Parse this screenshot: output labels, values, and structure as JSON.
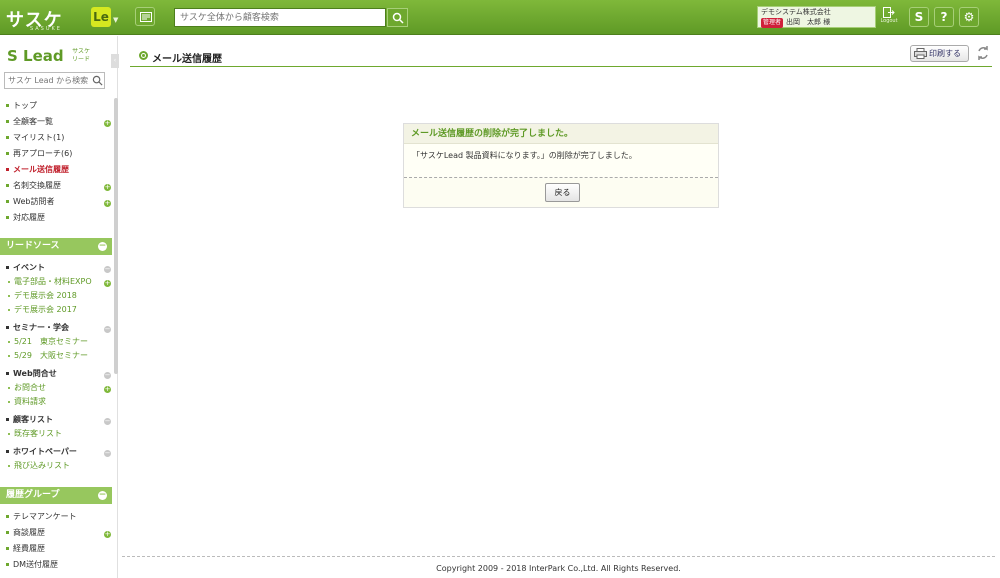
{
  "header": {
    "logo": "サスケ",
    "logo_sub": "SASUKE",
    "app_badge": "Le",
    "search_placeholder": "サスケ全体から顧客検索",
    "user": {
      "company": "デモシステム株式会社",
      "role_badge": "管理者",
      "name": "出岡　太郎 様"
    },
    "logout_label": "Logout"
  },
  "sidebar": {
    "logo": "Lead",
    "logo_sub_top": "サスケ",
    "logo_sub_bottom": "リード",
    "search_placeholder": "サスケ Lead から検索",
    "menu": [
      {
        "label": "トップ"
      },
      {
        "label": "全顧客一覧"
      },
      {
        "label": "マイリスト(1)"
      },
      {
        "label": "再アプローチ(6)"
      },
      {
        "label": "メール送信履歴"
      },
      {
        "label": "名刺交換履歴"
      },
      {
        "label": "Web訪問者"
      },
      {
        "label": "対応履歴"
      }
    ],
    "lead_source": {
      "title": "リードソース",
      "groups": [
        {
          "title": "イベント",
          "items": [
            "電子部品・材料EXPO",
            "デモ展示会 2018",
            "デモ展示会 2017"
          ]
        },
        {
          "title": "セミナー・学会",
          "items": [
            "5/21　東京セミナー",
            "5/29　大阪セミナー"
          ]
        },
        {
          "title": "Web問合せ",
          "items": [
            "お問合せ",
            "資料請求"
          ]
        },
        {
          "title": "顧客リスト",
          "items": [
            "既存客リスト"
          ]
        },
        {
          "title": "ホワイトペーパー",
          "items": [
            "飛び込みリスト"
          ]
        }
      ]
    },
    "history_group": {
      "title": "履歴グループ",
      "items": [
        "テレマアンケート",
        "商談履歴",
        "経費履歴",
        "DM送付履歴"
      ]
    }
  },
  "main": {
    "title": "メール送信履歴",
    "print_label": "印刷する",
    "dialog": {
      "heading": "メール送信履歴の削除が完了しました。",
      "message": "「サスケLead 製品資料になります。」の削除が完了しました。",
      "back_label": "戻る"
    }
  },
  "footer": {
    "copyright": "Copyright 2009 - 2018 InterPark Co.,Ltd. All Rights Reserved."
  },
  "colors": {
    "brand_green": "#6ea82e",
    "section_green": "#97c75e",
    "active_red": "#c0202c"
  }
}
